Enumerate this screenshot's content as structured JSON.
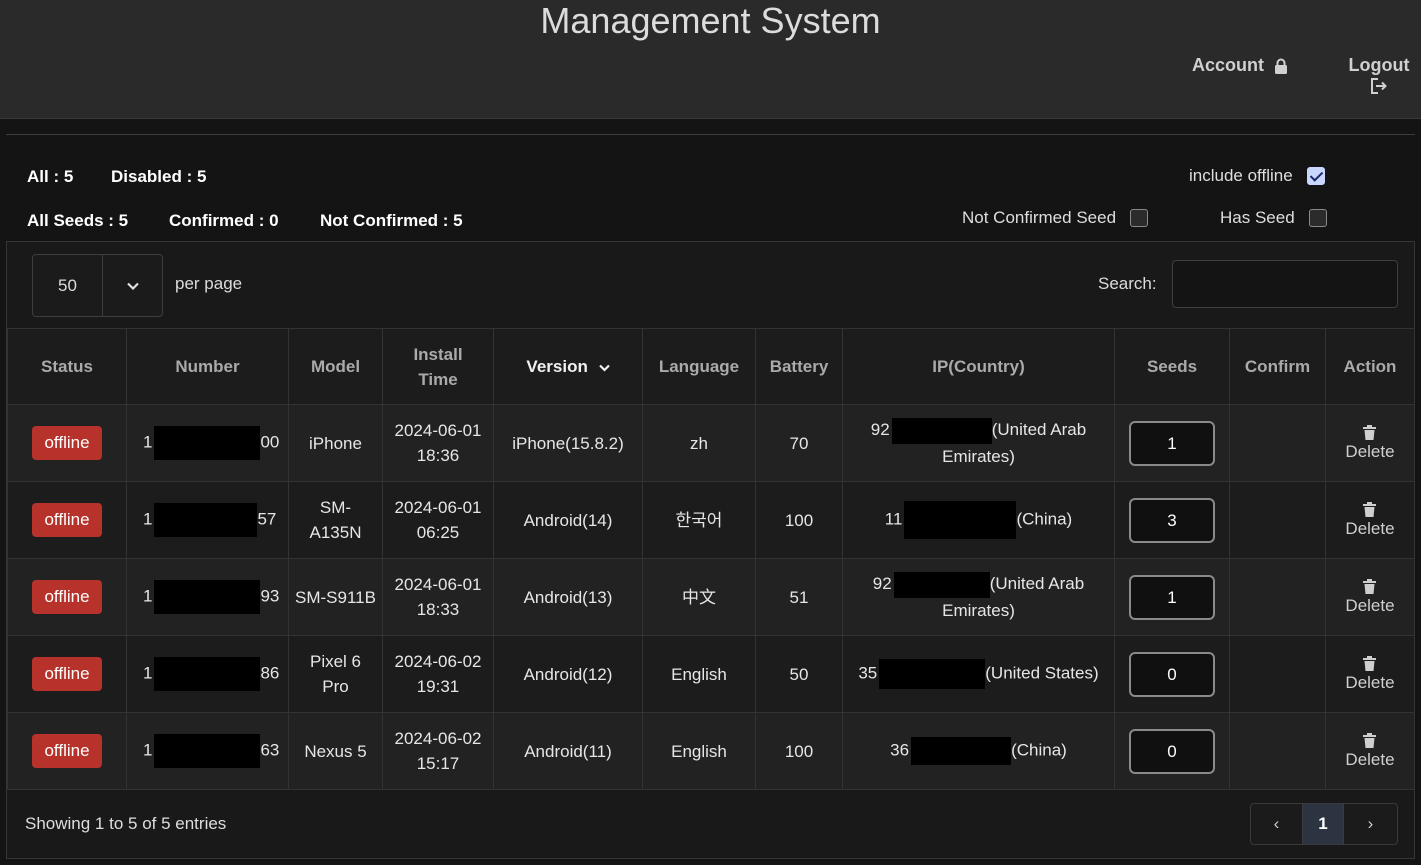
{
  "header": {
    "title": "Management System",
    "account_label": "Account",
    "account_icon": "lock-icon",
    "logout_label": "Logout",
    "logout_icon": "logout-icon"
  },
  "stats": {
    "all": "All : 5",
    "disabled": "Disabled : 5",
    "all_seeds": "All Seeds : 5",
    "confirmed": "Confirmed : 0",
    "not_confirmed": "Not Confirmed : 5"
  },
  "filters": {
    "include_offline": {
      "label": "include offline",
      "checked": true
    },
    "not_confirmed_seed": {
      "label": "Not Confirmed Seed",
      "checked": false
    },
    "has_seed": {
      "label": "Has Seed",
      "checked": false
    }
  },
  "table_controls": {
    "page_length": "50",
    "per_page_label": "per page",
    "search_label": "Search:",
    "search_value": ""
  },
  "columns": [
    "Status",
    "Number",
    "Model",
    "Install Time",
    "Version",
    "Language",
    "Battery",
    "IP(Country)",
    "Seeds",
    "Confirm",
    "Action"
  ],
  "rows": [
    {
      "status": "offline",
      "number_start": "1",
      "number_end": "00",
      "model": "iPhone",
      "install_time": "2024-06-01 18:36",
      "version": "iPhone(15.8.2)",
      "language": "zh",
      "battery": "70",
      "ip_start": "92",
      "ip_country": "(United Arab Emirates)",
      "seeds": "1",
      "confirm": "",
      "action": "Delete"
    },
    {
      "status": "offline",
      "number_start": "1",
      "number_end": "57",
      "model": "SM-A135N",
      "install_time": "2024-06-01 06:25",
      "version": "Android(14)",
      "language": "한국어",
      "battery": "100",
      "ip_start": "11",
      "ip_country": "(China)",
      "seeds": "3",
      "confirm": "",
      "action": "Delete"
    },
    {
      "status": "offline",
      "number_start": "1",
      "number_end": "93",
      "model": "SM-S911B",
      "install_time": "2024-06-01 18:33",
      "version": "Android(13)",
      "language": "中文",
      "battery": "51",
      "ip_start": "92",
      "ip_country": "(United Arab Emirates)",
      "seeds": "1",
      "confirm": "",
      "action": "Delete"
    },
    {
      "status": "offline",
      "number_start": "1",
      "number_end": "86",
      "model": "Pixel 6 Pro",
      "install_time": "2024-06-02 19:31",
      "version": "Android(12)",
      "language": "English",
      "battery": "50",
      "ip_start": "35",
      "ip_country": "(United States)",
      "seeds": "0",
      "confirm": "",
      "action": "Delete"
    },
    {
      "status": "offline",
      "number_start": "1",
      "number_end": "63",
      "model": "Nexus 5",
      "install_time": "2024-06-02 15:17",
      "version": "Android(11)",
      "language": "English",
      "battery": "100",
      "ip_start": "36",
      "ip_country": "(China)",
      "seeds": "0",
      "confirm": "",
      "action": "Delete"
    }
  ],
  "footer": {
    "info": "Showing 1 to 5 of 5 entries",
    "prev": "‹",
    "page": "1",
    "next": "›"
  },
  "colors": {
    "badge_offline": "#b8322c",
    "checkbox_checked": "#c9d7ff"
  }
}
